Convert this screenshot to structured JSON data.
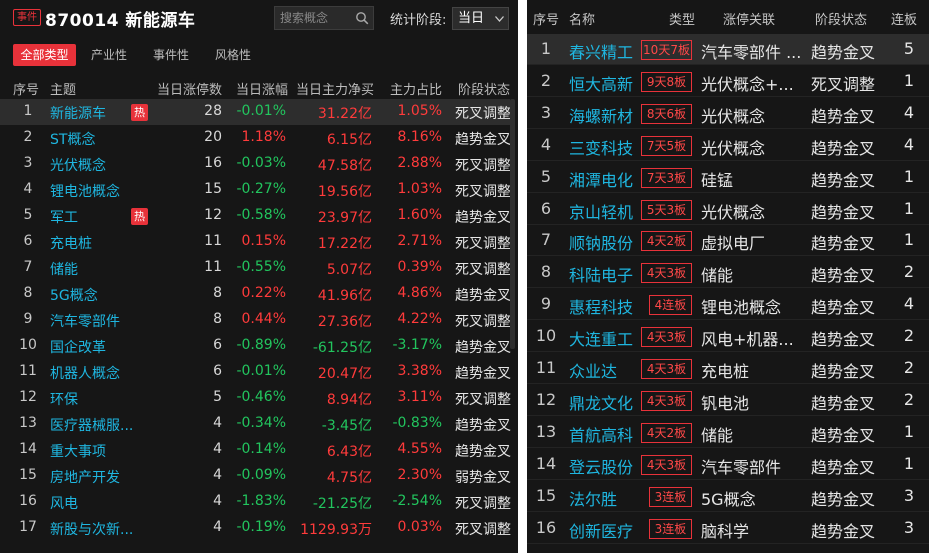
{
  "left": {
    "tag": "事件",
    "title": "870014 新能源车",
    "search_placeholder": "搜索概念",
    "stat_label": "统计阶段:",
    "period": "当日",
    "filters": [
      "全部类型",
      "产业性",
      "事件性",
      "风格性"
    ],
    "columns": [
      "序号",
      "主题",
      "当日涨停数",
      "当日涨幅",
      "当日主力净买",
      "主力占比",
      "阶段状态"
    ],
    "hot_label": "热",
    "rows": [
      {
        "idx": "1",
        "name": "新能源车",
        "hot": true,
        "count": "28",
        "pct": "-0.01%",
        "net": "31.22亿",
        "ratio": "1.05%",
        "stage": "死叉调整"
      },
      {
        "idx": "2",
        "name": "ST概念",
        "hot": false,
        "count": "20",
        "pct": "1.18%",
        "net": "6.15亿",
        "ratio": "8.16%",
        "stage": "趋势金叉"
      },
      {
        "idx": "3",
        "name": "光伏概念",
        "hot": false,
        "count": "16",
        "pct": "-0.03%",
        "net": "47.58亿",
        "ratio": "2.88%",
        "stage": "死叉调整"
      },
      {
        "idx": "4",
        "name": "锂电池概念",
        "hot": false,
        "count": "15",
        "pct": "-0.27%",
        "net": "19.56亿",
        "ratio": "1.03%",
        "stage": "死叉调整"
      },
      {
        "idx": "5",
        "name": "军工",
        "hot": true,
        "count": "12",
        "pct": "-0.58%",
        "net": "23.97亿",
        "ratio": "1.60%",
        "stage": "趋势金叉"
      },
      {
        "idx": "6",
        "name": "充电桩",
        "hot": false,
        "count": "11",
        "pct": "0.15%",
        "net": "17.22亿",
        "ratio": "2.71%",
        "stage": "死叉调整"
      },
      {
        "idx": "7",
        "name": "储能",
        "hot": false,
        "count": "11",
        "pct": "-0.55%",
        "net": "5.07亿",
        "ratio": "0.39%",
        "stage": "死叉调整"
      },
      {
        "idx": "8",
        "name": "5G概念",
        "hot": false,
        "count": "8",
        "pct": "0.22%",
        "net": "41.96亿",
        "ratio": "4.86%",
        "stage": "趋势金叉"
      },
      {
        "idx": "9",
        "name": "汽车零部件",
        "hot": false,
        "count": "8",
        "pct": "0.44%",
        "net": "27.36亿",
        "ratio": "4.22%",
        "stage": "死叉调整"
      },
      {
        "idx": "10",
        "name": "国企改革",
        "hot": false,
        "count": "6",
        "pct": "-0.89%",
        "net": "-61.25亿",
        "ratio": "-3.17%",
        "stage": "趋势金叉"
      },
      {
        "idx": "11",
        "name": "机器人概念",
        "hot": false,
        "count": "6",
        "pct": "-0.01%",
        "net": "20.47亿",
        "ratio": "3.38%",
        "stage": "趋势金叉"
      },
      {
        "idx": "12",
        "name": "环保",
        "hot": false,
        "count": "5",
        "pct": "-0.46%",
        "net": "8.94亿",
        "ratio": "3.11%",
        "stage": "死叉调整"
      },
      {
        "idx": "13",
        "name": "医疗器械服...",
        "hot": false,
        "count": "4",
        "pct": "-0.34%",
        "net": "-3.45亿",
        "ratio": "-0.83%",
        "stage": "趋势金叉"
      },
      {
        "idx": "14",
        "name": "重大事项",
        "hot": false,
        "count": "4",
        "pct": "-0.14%",
        "net": "6.43亿",
        "ratio": "4.55%",
        "stage": "趋势金叉"
      },
      {
        "idx": "15",
        "name": "房地产开发",
        "hot": false,
        "count": "4",
        "pct": "-0.09%",
        "net": "4.75亿",
        "ratio": "2.30%",
        "stage": "弱势金叉"
      },
      {
        "idx": "16",
        "name": "风电",
        "hot": false,
        "count": "4",
        "pct": "-1.83%",
        "net": "-21.25亿",
        "ratio": "-2.54%",
        "stage": "死叉调整"
      },
      {
        "idx": "17",
        "name": "新股与次新...",
        "hot": false,
        "count": "4",
        "pct": "-0.19%",
        "net": "1129.93万",
        "ratio": "0.03%",
        "stage": "死叉调整"
      }
    ]
  },
  "right": {
    "columns": [
      "序号",
      "名称",
      "类型",
      "涨停关联",
      "阶段状态",
      "连板"
    ],
    "rows": [
      {
        "idx": "1",
        "name": "春兴精工",
        "type": "10天7板",
        "rel": "汽车零部件 ...",
        "stage": "趋势金叉",
        "days": "5"
      },
      {
        "idx": "2",
        "name": "恒大高新",
        "type": "9天8板",
        "rel": "光伏概念+...",
        "stage": "死叉调整",
        "days": "1"
      },
      {
        "idx": "3",
        "name": "海螺新材",
        "type": "8天6板",
        "rel": "光伏概念",
        "stage": "趋势金叉",
        "days": "4"
      },
      {
        "idx": "4",
        "name": "三变科技",
        "type": "7天5板",
        "rel": "光伏概念",
        "stage": "趋势金叉",
        "days": "4"
      },
      {
        "idx": "5",
        "name": "湘潭电化",
        "type": "7天3板",
        "rel": "硅锰",
        "stage": "趋势金叉",
        "days": "1"
      },
      {
        "idx": "6",
        "name": "京山轻机",
        "type": "5天3板",
        "rel": "光伏概念",
        "stage": "趋势金叉",
        "days": "1"
      },
      {
        "idx": "7",
        "name": "顺钠股份",
        "type": "4天2板",
        "rel": "虚拟电厂",
        "stage": "趋势金叉",
        "days": "1"
      },
      {
        "idx": "8",
        "name": "科陆电子",
        "type": "4天3板",
        "rel": "储能",
        "stage": "趋势金叉",
        "days": "2"
      },
      {
        "idx": "9",
        "name": "惠程科技",
        "type": "4连板",
        "rel": "锂电池概念",
        "stage": "趋势金叉",
        "days": "4"
      },
      {
        "idx": "10",
        "name": "大连重工",
        "type": "4天3板",
        "rel": "风电+机器...",
        "stage": "趋势金叉",
        "days": "2"
      },
      {
        "idx": "11",
        "name": "众业达",
        "type": "4天3板",
        "rel": "充电桩",
        "stage": "趋势金叉",
        "days": "2"
      },
      {
        "idx": "12",
        "name": "鼎龙文化",
        "type": "4天3板",
        "rel": "钒电池",
        "stage": "趋势金叉",
        "days": "2"
      },
      {
        "idx": "13",
        "name": "首航高科",
        "type": "4天2板",
        "rel": "储能",
        "stage": "趋势金叉",
        "days": "1"
      },
      {
        "idx": "14",
        "name": "登云股份",
        "type": "4天3板",
        "rel": "汽车零部件",
        "stage": "趋势金叉",
        "days": "1"
      },
      {
        "idx": "15",
        "name": "法尔胜",
        "type": "3连板",
        "rel": "5G概念",
        "stage": "趋势金叉",
        "days": "3"
      },
      {
        "idx": "16",
        "name": "创新医疗",
        "type": "3连板",
        "rel": "脑科学",
        "stage": "趋势金叉",
        "days": "3"
      }
    ]
  },
  "colors": {
    "up": "#ff3b3b",
    "down": "#22c55e",
    "link": "#1fb6e0",
    "accent": "#e8323a"
  }
}
